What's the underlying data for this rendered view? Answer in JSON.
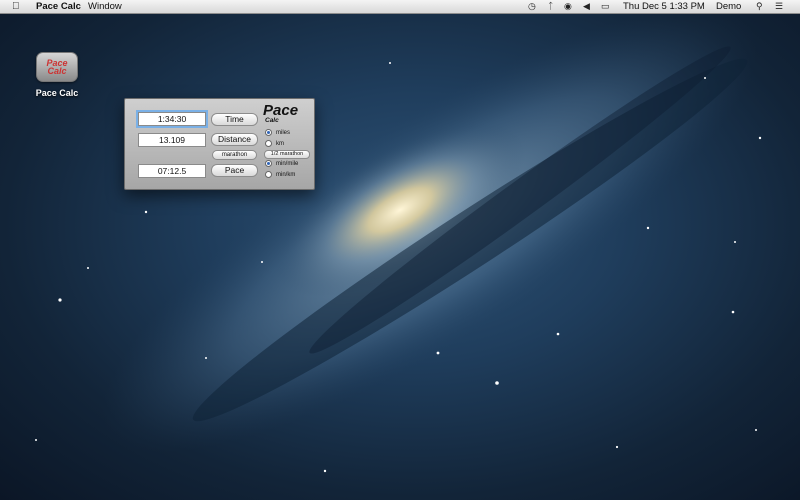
{
  "menubar": {
    "apple_icon": "apple-icon",
    "app_name": "Pace Calc",
    "window_menu": "Window",
    "status_icons": [
      "time-machine-icon",
      "bluetooth-icon",
      "wifi-icon",
      "volume-icon",
      "battery-icon"
    ],
    "datetime": "Thu Dec 5  1:33 PM",
    "user": "Demo",
    "spotlight_icon": "search-icon",
    "notifications_icon": "list-icon"
  },
  "desktop": {
    "icon_text": "Pace Calc",
    "icon_label": "Pace Calc"
  },
  "window": {
    "time_value": "1:34:30",
    "time_button": "Time",
    "distance_value": "13.109",
    "distance_button": "Distance",
    "marathon_button": "marathon",
    "pace_value": "07:12.5",
    "pace_button": "Pace",
    "logo_title": "Pace",
    "logo_subtitle": "Calc",
    "unit_options": [
      {
        "label": "miles",
        "selected": true
      },
      {
        "label": "km",
        "selected": false
      }
    ],
    "half_marathon_button": "1/2 marathon",
    "pace_unit_options": [
      {
        "label": "min/mile",
        "selected": true
      },
      {
        "label": "min/km",
        "selected": false
      }
    ]
  }
}
